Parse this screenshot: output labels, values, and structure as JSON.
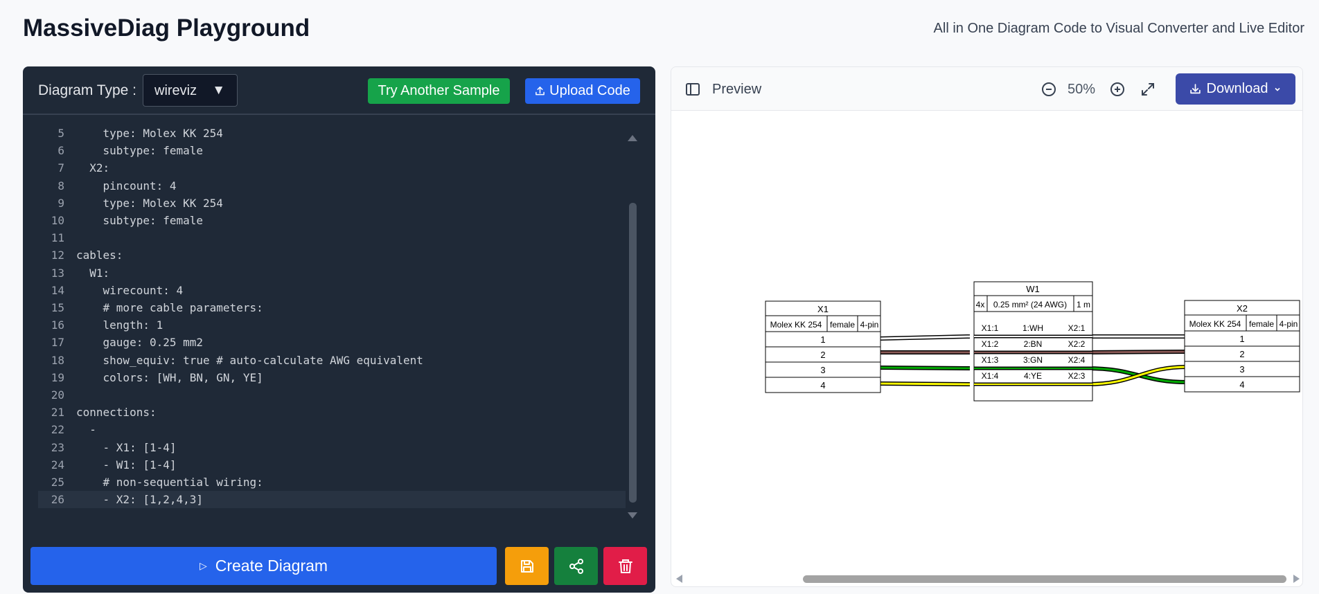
{
  "header": {
    "title": "MassiveDiag Playground",
    "subtitle": "All in One Diagram Code to Visual Converter and Live Editor"
  },
  "editor": {
    "type_label": "Diagram Type :",
    "type_value": "wireviz",
    "try_sample_label": "Try Another Sample",
    "upload_label": "Upload Code",
    "create_label": "Create Diagram",
    "lines": [
      {
        "n": "5",
        "text": "    type: Molex KK 254"
      },
      {
        "n": "6",
        "text": "    subtype: female"
      },
      {
        "n": "7",
        "text": "  X2:"
      },
      {
        "n": "8",
        "text": "    pincount: 4"
      },
      {
        "n": "9",
        "text": "    type: Molex KK 254"
      },
      {
        "n": "10",
        "text": "    subtype: female"
      },
      {
        "n": "11",
        "text": ""
      },
      {
        "n": "12",
        "text": "cables:"
      },
      {
        "n": "13",
        "text": "  W1:"
      },
      {
        "n": "14",
        "text": "    wirecount: 4"
      },
      {
        "n": "15",
        "text": "    # more cable parameters:"
      },
      {
        "n": "16",
        "text": "    length: 1"
      },
      {
        "n": "17",
        "text": "    gauge: 0.25 mm2"
      },
      {
        "n": "18",
        "text": "    show_equiv: true # auto-calculate AWG equivalent"
      },
      {
        "n": "19",
        "text": "    colors: [WH, BN, GN, YE]"
      },
      {
        "n": "20",
        "text": ""
      },
      {
        "n": "21",
        "text": "connections:"
      },
      {
        "n": "22",
        "text": "  -"
      },
      {
        "n": "23",
        "text": "    - X1: [1-4]"
      },
      {
        "n": "24",
        "text": "    - W1: [1-4]"
      },
      {
        "n": "25",
        "text": "    # non-sequential wiring:"
      },
      {
        "n": "26",
        "text": "    - X2: [1,2,4,3]"
      }
    ]
  },
  "preview": {
    "label": "Preview",
    "zoom": "50%",
    "download_label": "Download"
  },
  "diagram": {
    "x1": {
      "name": "X1",
      "type": "Molex KK 254",
      "subtype": "female",
      "pins_label": "4-pin",
      "pins": [
        "1",
        "2",
        "3",
        "4"
      ]
    },
    "x2": {
      "name": "X2",
      "type": "Molex KK 254",
      "subtype": "female",
      "pins_label": "4-pin",
      "pins": [
        "1",
        "2",
        "3",
        "4"
      ]
    },
    "w1": {
      "name": "W1",
      "count": "4x",
      "gauge": "0.25 mm² (24 AWG)",
      "length": "1 m",
      "wires": [
        {
          "from": "X1:1",
          "color": "1:WH",
          "to": "X2:1"
        },
        {
          "from": "X1:2",
          "color": "2:BN",
          "to": "X2:2"
        },
        {
          "from": "X1:3",
          "color": "3:GN",
          "to": "X2:4"
        },
        {
          "from": "X1:4",
          "color": "4:YE",
          "to": "X2:3"
        }
      ]
    }
  },
  "colors": {
    "wire_wh": "#ffffff",
    "wire_bn": "#895956",
    "wire_gn": "#00aa00",
    "wire_ye": "#ffff00",
    "accent_blue": "#2563eb",
    "sample_green": "#16a34a",
    "download_indigo": "#3b4aa8"
  },
  "icons": [
    "sidebar-toggle-icon",
    "zoom-out-icon",
    "zoom-in-icon",
    "expand-icon",
    "download-icon",
    "chevron-down-icon",
    "upload-icon",
    "play-icon",
    "save-icon",
    "share-icon",
    "trash-icon"
  ]
}
